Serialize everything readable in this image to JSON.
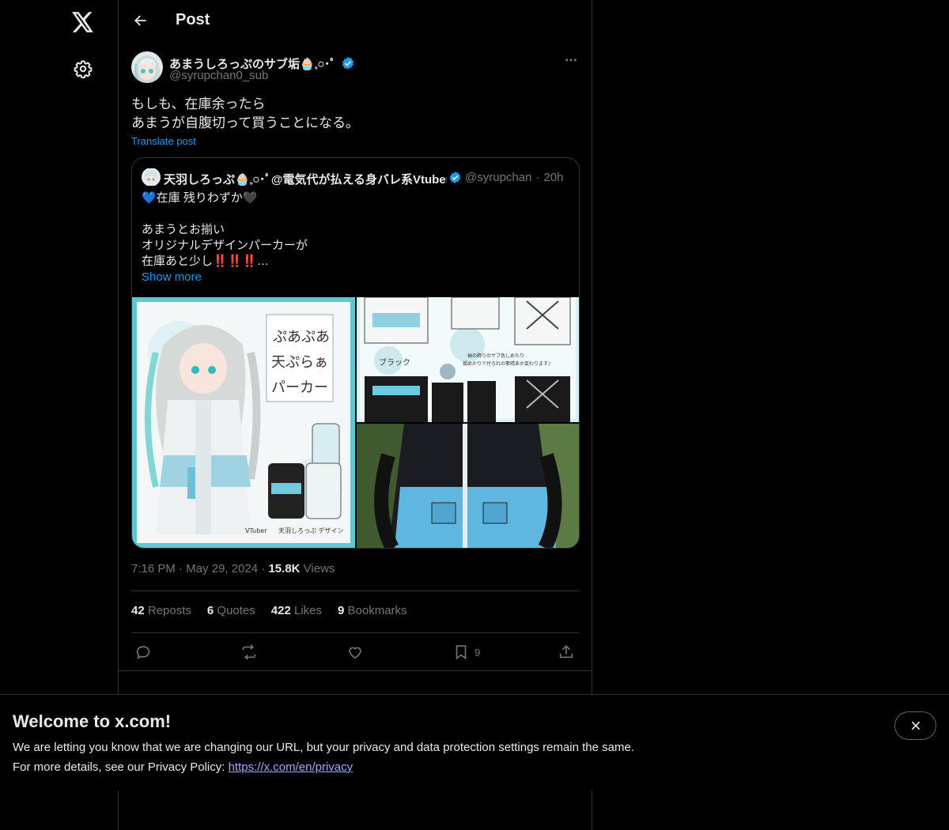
{
  "nav": {
    "logo": "x-logo-icon",
    "settings": "gear-icon"
  },
  "header": {
    "title": "Post"
  },
  "post": {
    "author_name": "あまうしろっぷのサブ垢🧁𓈒𓏸･ﾟ",
    "author_handle": "@syrupchan0_sub",
    "verified": true,
    "text_lines": [
      "もしも、在庫余ったら",
      "あまうが自腹切って買うことになる。"
    ],
    "translate_label": "Translate post",
    "time": "7:16 PM",
    "date": "May 29, 2024",
    "views_count": "15.8K",
    "views_label": "Views"
  },
  "quote": {
    "author_name": "天羽しろっぷ🧁𓈒𓏸･ﾟ@電気代が払える身バレ系Vtuber",
    "author_handle": "@syrupchan",
    "time_ago": "20h",
    "lines": [
      "💙在庫 残りわずか🖤",
      "",
      "あまうとお揃い",
      "オリジナルデザインパーカーが",
      "在庫あと少し‼️‼️‼️…"
    ],
    "show_more": "Show more",
    "image_texts": {
      "title_lines": [
        "ぷあぷあ",
        "天ぷらぁ",
        "パーカー"
      ],
      "credit_a": "VTuber",
      "credit_b": "天羽しろっぷ デザイン",
      "black_label": "ブラック",
      "note_lines": [
        "袖の飾りのサブ色しめたり",
        "揺めかりで付ろれの素晴あか変わります♪"
      ]
    }
  },
  "stats": [
    {
      "count": "42",
      "label": "Reposts"
    },
    {
      "count": "6",
      "label": "Quotes"
    },
    {
      "count": "422",
      "label": "Likes"
    },
    {
      "count": "9",
      "label": "Bookmarks"
    }
  ],
  "actions": {
    "reply": "reply-icon",
    "repost": "repost-icon",
    "like": "heart-icon",
    "bookmark": "bookmark-icon",
    "bookmark_count": "9",
    "share": "share-icon"
  },
  "banner": {
    "title": "Welcome to x.com!",
    "line1": "We are letting you know that we are changing our URL, but your privacy and data protection settings remain the same.",
    "line2_prefix": "For more details, see our Privacy Policy: ",
    "link": "https://x.com/en/privacy"
  },
  "colors": {
    "background": "#000000",
    "text": "#e7e9ea",
    "muted": "#71767b",
    "accent": "#1d9bf0",
    "border": "#2f3336"
  }
}
